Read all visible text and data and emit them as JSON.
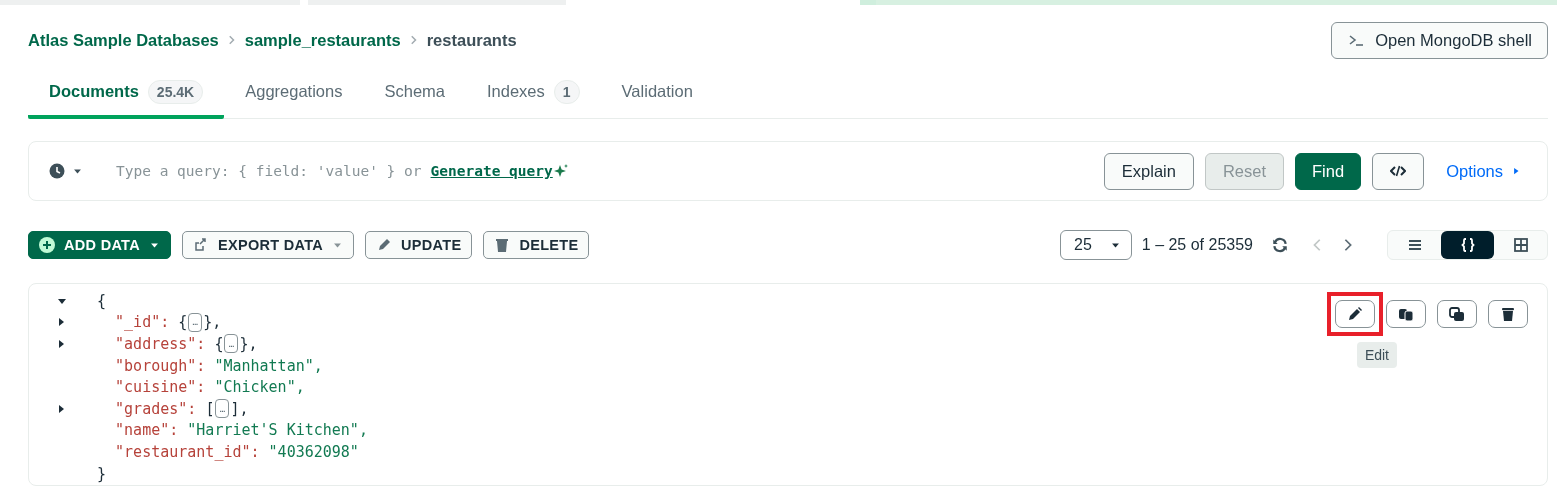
{
  "breadcrumb": [
    {
      "label": "Atlas Sample Databases",
      "kind": "link"
    },
    {
      "label": "sample_restaurants",
      "kind": "link"
    },
    {
      "label": "restaurants",
      "kind": "current"
    }
  ],
  "shell_button": {
    "label": "Open MongoDB shell"
  },
  "tabs": [
    {
      "label": "Documents",
      "count": "25.4K",
      "selected": true
    },
    {
      "label": "Aggregations",
      "selected": false
    },
    {
      "label": "Schema",
      "selected": false
    },
    {
      "label": "Indexes",
      "count": "1",
      "selected": false
    },
    {
      "label": "Validation",
      "selected": false
    }
  ],
  "query": {
    "hint": "Type a query: { field: 'value' } or",
    "generate_link": "Generate query",
    "options": "Options",
    "buttons": [
      {
        "label": "Explain",
        "kind": "secondary",
        "disabled": false
      },
      {
        "label": "Reset",
        "kind": "secondary",
        "disabled": true
      },
      {
        "label": "Find",
        "kind": "primary",
        "disabled": false
      },
      {
        "kind": "code",
        "disabled": false
      }
    ]
  },
  "toolbar": {
    "actions": [
      {
        "label": "ADD DATA",
        "kind": "add",
        "dropdown": true
      },
      {
        "label": "EXPORT DATA",
        "kind": "export",
        "dropdown": true
      },
      {
        "label": "UPDATE",
        "kind": "update",
        "dropdown": false
      },
      {
        "label": "DELETE",
        "kind": "delete",
        "dropdown": false
      }
    ],
    "page_size": "25",
    "range": "1 – 25 of 25359",
    "views": [
      {
        "kind": "list",
        "selected": false
      },
      {
        "kind": "json",
        "selected": true
      },
      {
        "kind": "table",
        "selected": false
      }
    ]
  },
  "document": {
    "open": "{",
    "close": "}",
    "expanded": true,
    "fields": [
      {
        "key": "\"_id\":",
        "kind": "object",
        "open": "{",
        "preview": "…",
        "close": "},",
        "expanded": false
      },
      {
        "key": "\"address\":",
        "kind": "object",
        "open": "{",
        "preview": "…",
        "close": "},",
        "expanded": false
      },
      {
        "key": "\"borough\":",
        "kind": "string",
        "value": "\"Manhattan\","
      },
      {
        "key": "\"cuisine\":",
        "kind": "string",
        "value": "\"Chicken\","
      },
      {
        "key": "\"grades\":",
        "kind": "array",
        "open": "[",
        "preview": "…",
        "close": "],",
        "expanded": false
      },
      {
        "key": "\"name\":",
        "kind": "string",
        "value": "\"Harriet'S Kitchen\","
      },
      {
        "key": "\"restaurant_id\":",
        "kind": "string",
        "value": "\"40362098\""
      }
    ],
    "actions": [
      {
        "kind": "edit",
        "highlighted": true
      },
      {
        "kind": "copy",
        "highlighted": false
      },
      {
        "kind": "clone",
        "highlighted": false
      },
      {
        "kind": "delete",
        "highlighted": false
      }
    ],
    "tooltip": "Edit"
  }
}
